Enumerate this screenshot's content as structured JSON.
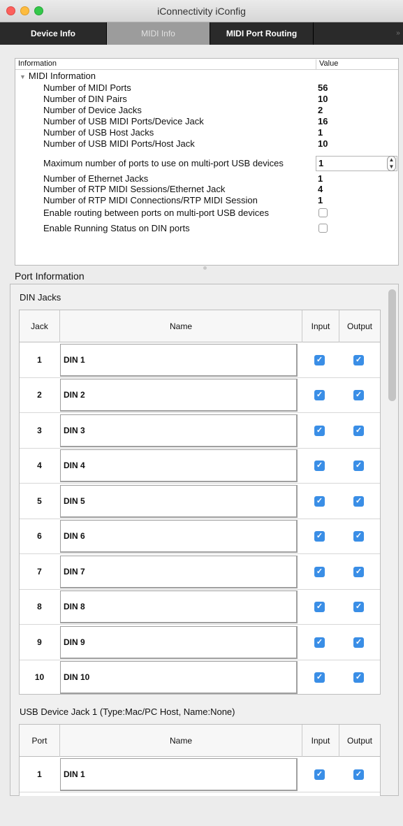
{
  "window": {
    "title": "iConnectivity iConfig"
  },
  "tabs": [
    {
      "label": "Device Info",
      "active": false
    },
    {
      "label": "MIDI Info",
      "active": true
    },
    {
      "label": "MIDI Port Routing",
      "active": false
    }
  ],
  "info": {
    "col_information": "Information",
    "col_value": "Value",
    "root_label": "MIDI Information",
    "rows": [
      {
        "label": "Number of MIDI Ports",
        "value": "56"
      },
      {
        "label": "Number of DIN Pairs",
        "value": "10"
      },
      {
        "label": "Number of Device Jacks",
        "value": "2"
      },
      {
        "label": "Number of USB MIDI Ports/Device Jack",
        "value": "16"
      },
      {
        "label": "Number of USB Host Jacks",
        "value": "1"
      },
      {
        "label": "Number of USB MIDI Ports/Host Jack",
        "value": "10"
      },
      {
        "label": "Maximum number of ports to use on multi-port USB devices",
        "value": "1"
      },
      {
        "label": "Number of Ethernet Jacks",
        "value": "1"
      },
      {
        "label": "Number of RTP MIDI Sessions/Ethernet Jack",
        "value": "4"
      },
      {
        "label": "Number of RTP MIDI Connections/RTP MIDI Session",
        "value": "1"
      },
      {
        "label": "Enable routing between ports on multi-port USB devices",
        "checked": false
      },
      {
        "label": "Enable Running Status on DIN ports",
        "checked": false
      }
    ]
  },
  "port_info": {
    "label": "Port Information",
    "din": {
      "label": "DIN Jacks",
      "col_num": "Jack",
      "col_name": "Name",
      "col_input": "Input",
      "col_output": "Output",
      "rows": [
        {
          "num": "1",
          "name": "DIN 1",
          "input": true,
          "output": true
        },
        {
          "num": "2",
          "name": "DIN 2",
          "input": true,
          "output": true
        },
        {
          "num": "3",
          "name": "DIN 3",
          "input": true,
          "output": true
        },
        {
          "num": "4",
          "name": "DIN 4",
          "input": true,
          "output": true
        },
        {
          "num": "5",
          "name": "DIN 5",
          "input": true,
          "output": true
        },
        {
          "num": "6",
          "name": "DIN 6",
          "input": true,
          "output": true
        },
        {
          "num": "7",
          "name": "DIN 7",
          "input": true,
          "output": true
        },
        {
          "num": "8",
          "name": "DIN 8",
          "input": true,
          "output": true
        },
        {
          "num": "9",
          "name": "DIN 9",
          "input": true,
          "output": true
        },
        {
          "num": "10",
          "name": "DIN 10",
          "input": true,
          "output": true
        }
      ]
    },
    "usb": {
      "label": "USB Device Jack 1 (Type:Mac/PC Host, Name:None)",
      "col_num": "Port",
      "col_name": "Name",
      "col_input": "Input",
      "col_output": "Output",
      "rows": [
        {
          "num": "1",
          "name": "DIN 1",
          "input": true,
          "output": true
        }
      ]
    }
  }
}
